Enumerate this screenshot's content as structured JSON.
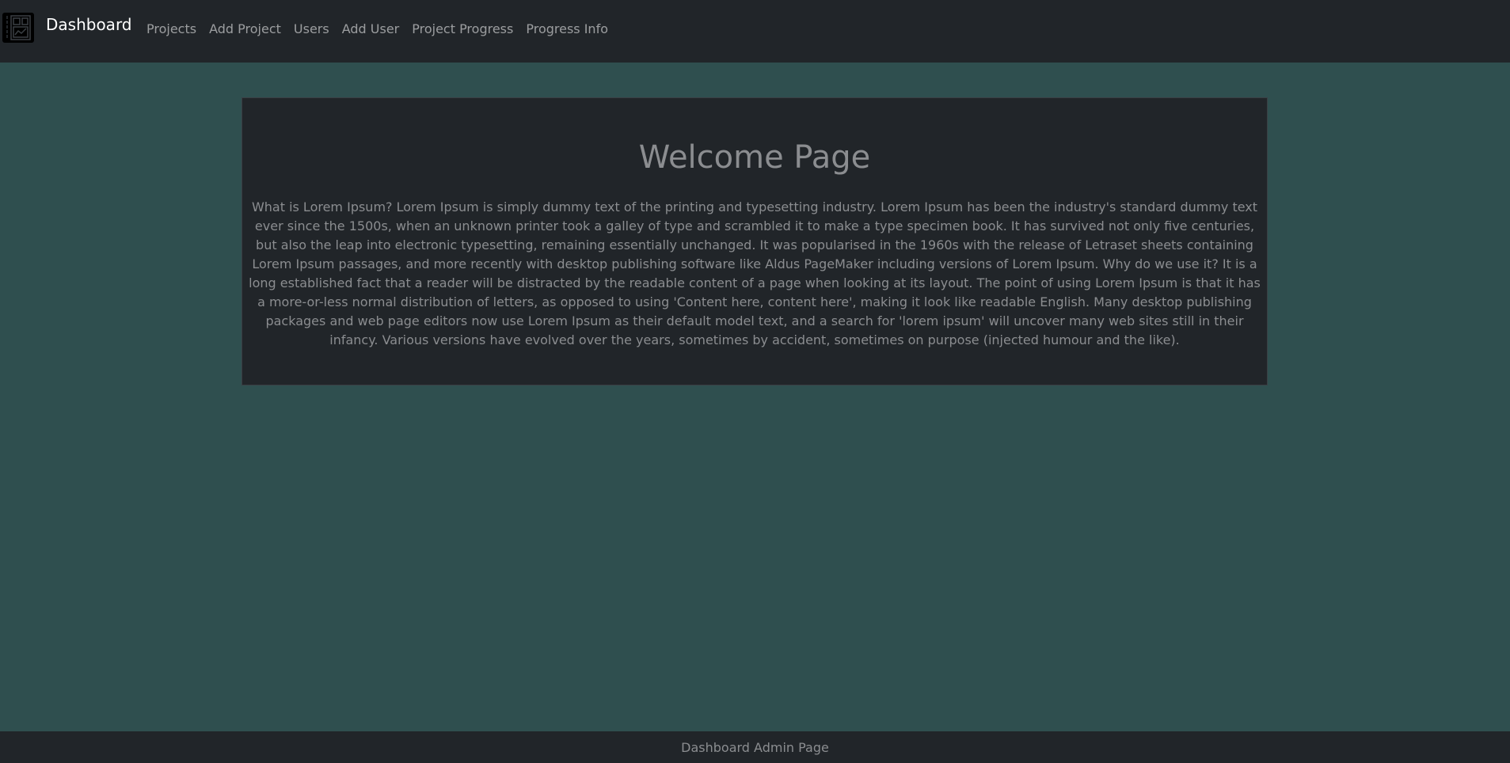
{
  "navbar": {
    "brand": {
      "icon": "dashboard-logo-icon",
      "label": "Dashboard"
    },
    "links": [
      {
        "label": "Projects"
      },
      {
        "label": "Add Project"
      },
      {
        "label": "Users"
      },
      {
        "label": "Add User"
      },
      {
        "label": "Project Progress"
      },
      {
        "label": "Progress Info"
      }
    ]
  },
  "main": {
    "title": "Welcome Page",
    "body": "What is Lorem Ipsum? Lorem Ipsum is simply dummy text of the printing and typesetting industry. Lorem Ipsum has been the industry's standard dummy text ever since the 1500s, when an unknown printer took a galley of type and scrambled it to make a type specimen book. It has survived not only five centuries, but also the leap into electronic typesetting, remaining essentially unchanged. It was popularised in the 1960s with the release of Letraset sheets containing Lorem Ipsum passages, and more recently with desktop publishing software like Aldus PageMaker including versions of Lorem Ipsum. Why do we use it? It is a long established fact that a reader will be distracted by the readable content of a page when looking at its layout. The point of using Lorem Ipsum is that it has a more-or-less normal distribution of letters, as opposed to using 'Content here, content here', making it look like readable English. Many desktop publishing packages and web page editors now use Lorem Ipsum as their default model text, and a search for 'lorem ipsum' will uncover many web sites still in their infancy. Various versions have evolved over the years, sometimes by accident, sometimes on purpose (injected humour and the like)."
  },
  "footer": {
    "text": "Dashboard Admin Page"
  },
  "colors": {
    "page_background": "#2f4f4f",
    "navbar_background": "#212529",
    "card_background": "#212529",
    "muted_text": "#8b8d90",
    "brand_text": "#ffffff"
  }
}
